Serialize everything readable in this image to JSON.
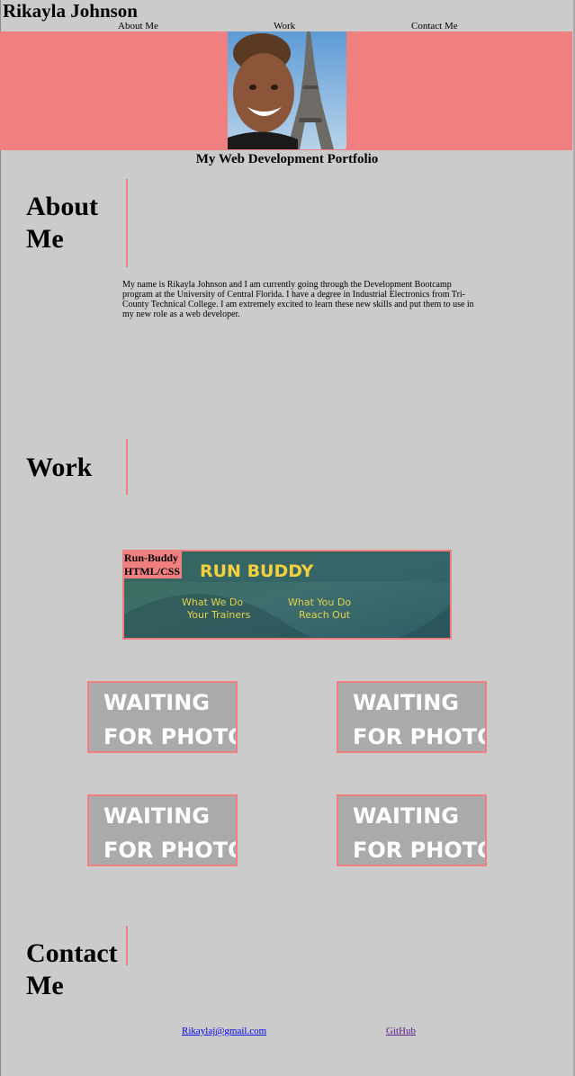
{
  "header": {
    "title": "Rikayla Johnson",
    "nav": [
      "About Me",
      "Work",
      "Contact Me"
    ]
  },
  "hero": {
    "subtitle": "My Web Development Portfolio"
  },
  "about": {
    "heading": "About Me",
    "text": "My name is Rikayla Johnson and I am currently going through the Development Bootcamp program at the University of Central Florida. I have a degree in Industrial Electronics from Tri-County Technical College. I am extremely excited to learn these new skills and put them to use in my new role as a web developer."
  },
  "work": {
    "heading": "Work",
    "featured": {
      "label_line1": "Run-Buddy",
      "label_line2": "HTML/CSS",
      "image_title": "RUN BUDDY",
      "image_links": [
        "What We Do",
        "What You Do",
        "Your Trainers",
        "Reach Out"
      ]
    },
    "placeholders": [
      "WAITING FOR PHOTO",
      "WAITING FOR PHOTO",
      "WAITING FOR PHOTO",
      "WAITING FOR PHOTO"
    ]
  },
  "contact": {
    "heading": "Contact Me",
    "email": "Rikaylaj@gmail.com",
    "github": "GitHub"
  },
  "colors": {
    "background": "#cbcbcb",
    "accent": "#f08080",
    "link": "#0000ee",
    "visited_link": "#551a8b"
  }
}
